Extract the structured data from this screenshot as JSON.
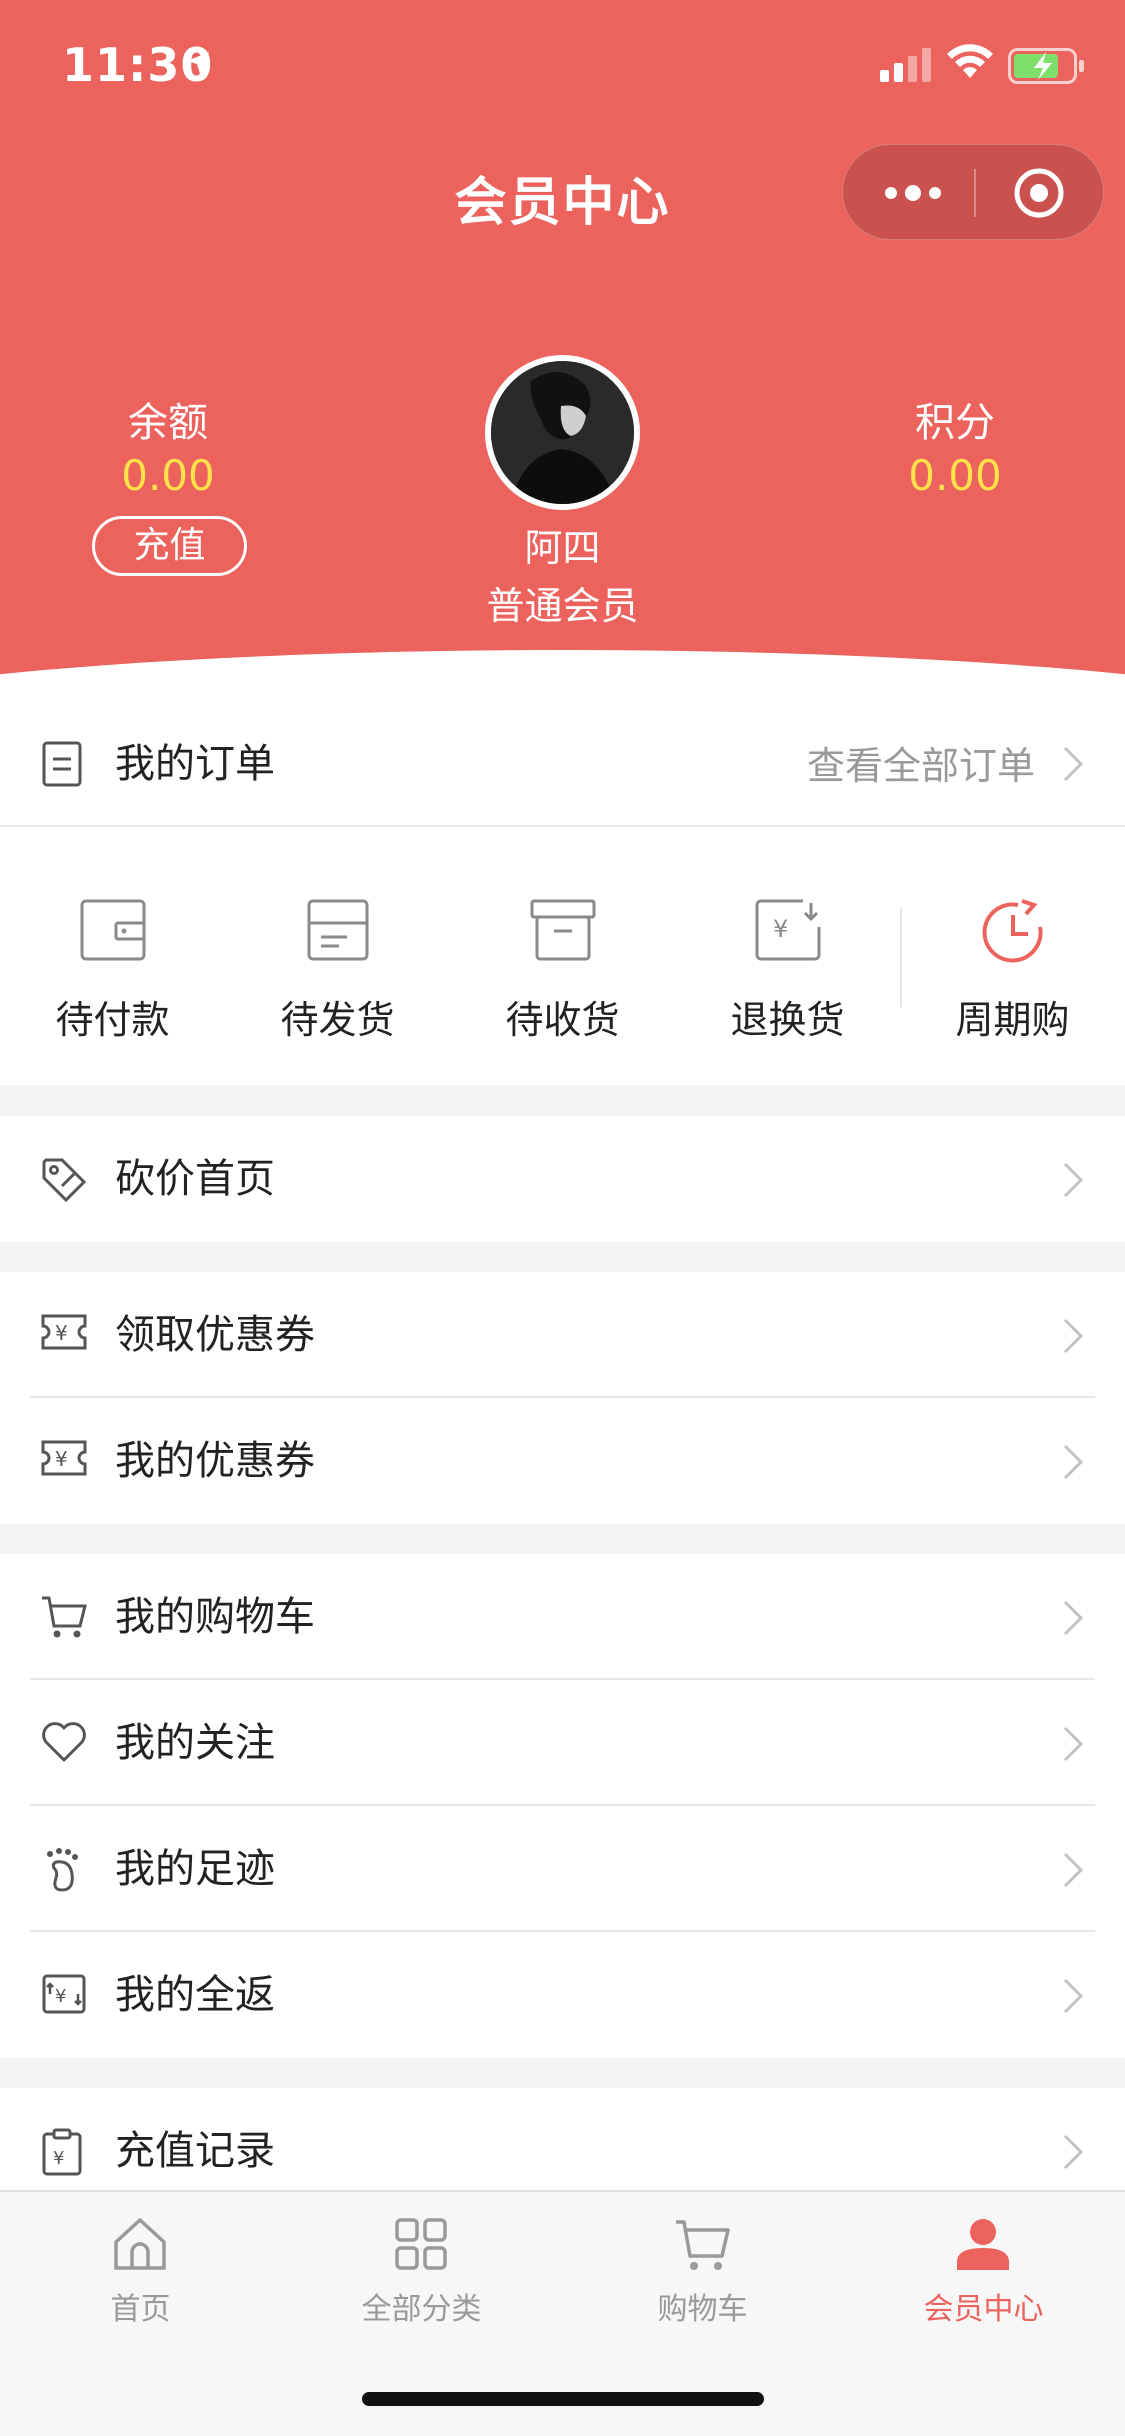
{
  "status_bar": {
    "time": "11:30"
  },
  "nav": {
    "title": "会员中心"
  },
  "profile": {
    "balance_label": "余额",
    "balance_value": "0.00",
    "recharge_label": "充值",
    "points_label": "积分",
    "points_value": "0.00",
    "name": "阿四",
    "level": "普通会员"
  },
  "orders": {
    "title": "我的订单",
    "view_all": "查看全部订单",
    "items": [
      {
        "label": "待付款",
        "icon": "wallet-icon"
      },
      {
        "label": "待发货",
        "icon": "package-icon"
      },
      {
        "label": "待收货",
        "icon": "box-icon"
      },
      {
        "label": "退换货",
        "icon": "refund-icon"
      },
      {
        "label": "周期购",
        "icon": "clock-icon"
      }
    ]
  },
  "menu": {
    "bargain": "砍价首页",
    "get_coupons": "领取优惠券",
    "my_coupons": "我的优惠券",
    "cart": "我的购物车",
    "follow": "我的关注",
    "footprint": "我的足迹",
    "full_return": "我的全返",
    "recharge_records": "充值记录"
  },
  "tabbar": {
    "items": [
      {
        "label": "首页",
        "icon": "home-icon"
      },
      {
        "label": "全部分类",
        "icon": "grid-icon"
      },
      {
        "label": "购物车",
        "icon": "cart-icon"
      },
      {
        "label": "会员中心",
        "icon": "user-icon"
      }
    ],
    "active_index": 3
  },
  "colors": {
    "brand": "#ec625d",
    "highlight_value": "#ffe14a",
    "icon_gray": "#666666"
  }
}
